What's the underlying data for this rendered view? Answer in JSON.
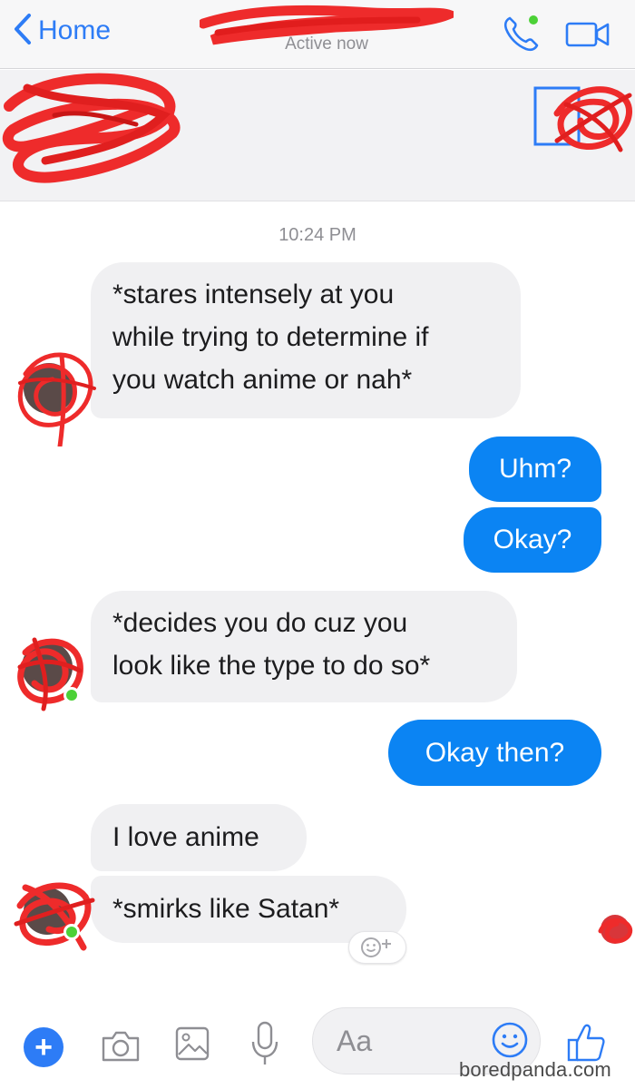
{
  "nav": {
    "back_label": "Home",
    "status": "Active now",
    "back_icon": "chevron-left-icon",
    "call_icon": "phone-icon",
    "video_icon": "video-camera-icon",
    "accent_color": "#2d7cf6"
  },
  "chat": {
    "timestamp": "10:24 PM",
    "messages": [
      {
        "side": "incoming",
        "lines": [
          "*stares intensely at you",
          "while trying to determine if",
          "you watch anime or nah*"
        ]
      },
      {
        "side": "outgoing",
        "text": "Uhm?"
      },
      {
        "side": "outgoing",
        "text": "Okay?"
      },
      {
        "side": "incoming",
        "lines": [
          "*decides you do cuz you",
          "look like the type to do so*"
        ]
      },
      {
        "side": "outgoing",
        "text": "Okay then?"
      },
      {
        "side": "incoming",
        "text": "I love anime"
      },
      {
        "side": "incoming",
        "text": "*smirks like Satan*"
      }
    ],
    "outgoing_color": "#0b84f3",
    "incoming_color": "#f0f0f2"
  },
  "composer": {
    "placeholder": "Aa",
    "icons": [
      "plus-icon",
      "camera-icon",
      "photo-icon",
      "microphone-icon",
      "emoji-icon",
      "thumbs-up-icon"
    ]
  },
  "watermark": "boredpanda.com"
}
